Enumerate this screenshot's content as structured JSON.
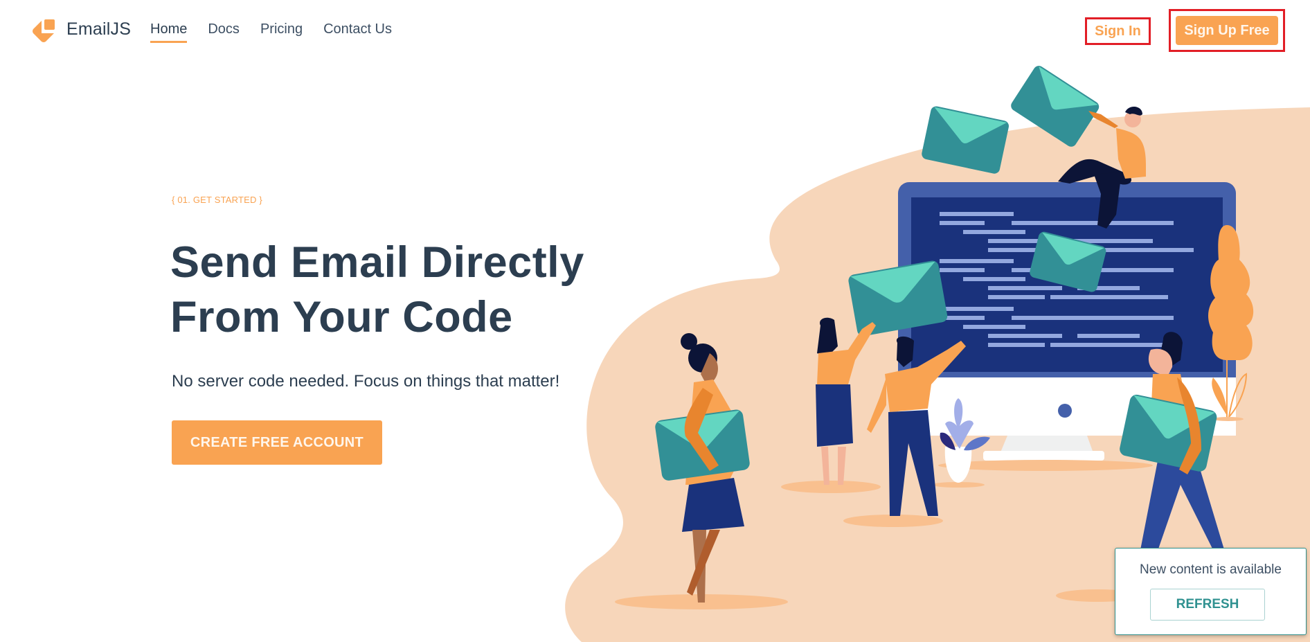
{
  "brand": {
    "name": "EmailJS",
    "logo_icon": "emailjs-logo-icon",
    "accent_color": "#f9a352"
  },
  "nav": {
    "items": [
      {
        "label": "Home",
        "active": true
      },
      {
        "label": "Docs",
        "active": false
      },
      {
        "label": "Pricing",
        "active": false
      },
      {
        "label": "Contact Us",
        "active": false
      }
    ]
  },
  "auth": {
    "sign_in_label": "Sign In",
    "sign_up_label": "Sign Up Free",
    "highlight_color": "#e21e26"
  },
  "hero": {
    "eyebrow": "{ 01. GET STARTED }",
    "headline_line1": "Send Email Directly",
    "headline_line2": "From Your Code",
    "subtitle": "No server code needed. Focus on things that matter!",
    "cta_label": "CREATE FREE ACCOUNT"
  },
  "illustration": {
    "description": "People carrying envelopes around a large monitor with code lines",
    "colors": {
      "blob": "#f7d6ba",
      "monitor_frame": "#4460aa",
      "screen": "#1a327c",
      "code_line": "#93a8df",
      "envelope_light": "#63d6c1",
      "envelope_dark": "#329096",
      "shirt": "#f9a352"
    }
  },
  "toast": {
    "message": "New content is available",
    "button_label": "REFRESH",
    "accent_color": "#2f9190"
  }
}
